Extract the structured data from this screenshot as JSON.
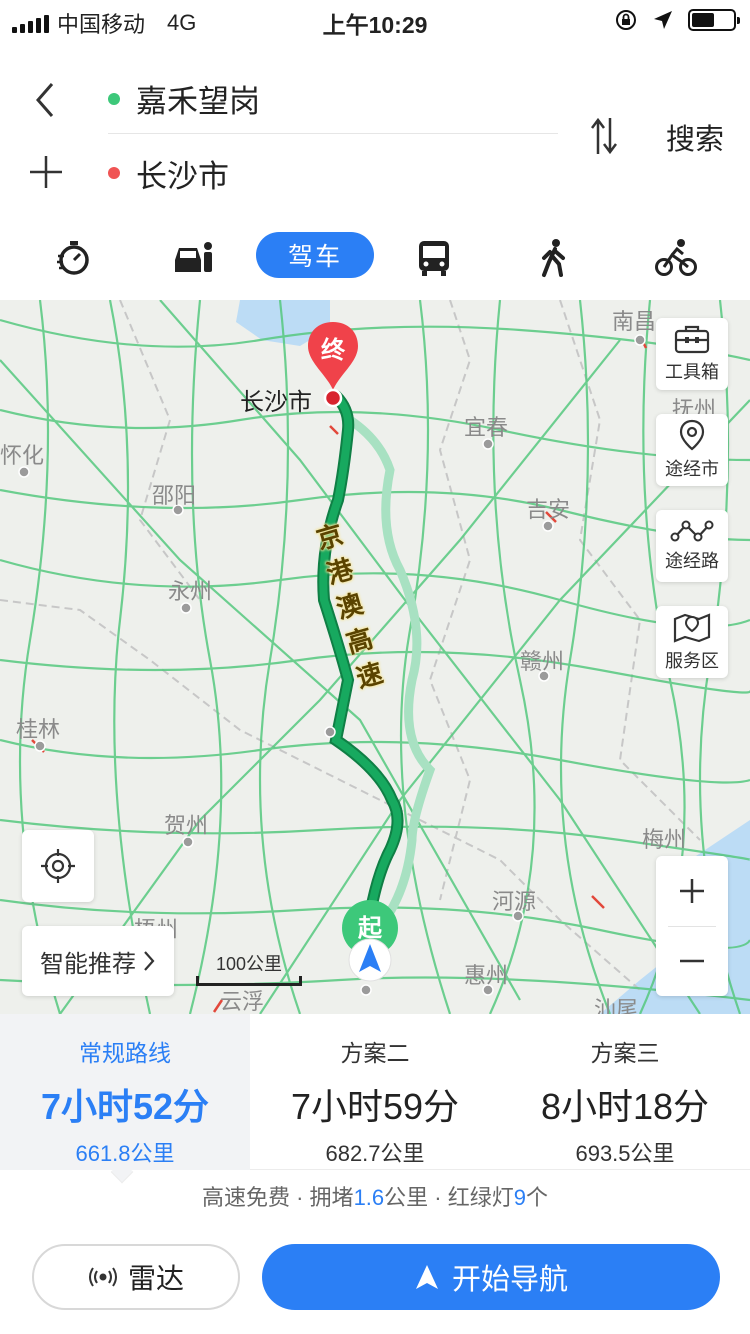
{
  "status_bar": {
    "carrier": "中国移动",
    "network": "4G",
    "time": "上午10:29",
    "battery_level": 0.55
  },
  "route_input": {
    "origin": "嘉禾望岗",
    "destination": "长沙市",
    "search_label": "搜索",
    "origin_dot_color": "#3dc87a",
    "destination_dot_color": "#f05454"
  },
  "modes": {
    "active_label": "驾车",
    "items": [
      "timer-icon",
      "taxi-icon",
      "drive",
      "bus-icon",
      "walk-icon",
      "bike-icon"
    ]
  },
  "map": {
    "labels": {
      "nanchang": "南昌",
      "fuzhou": "抚州",
      "yichun": "宜春",
      "jian": "吉安",
      "huaihua": "怀化",
      "shaoyang": "邵阳",
      "yongzhou": "永州",
      "ganzhou": "赣州",
      "guilin": "桂林",
      "hezhou": "贺州",
      "meizhou": "梅州",
      "heyuan": "河源",
      "huizhou": "惠州",
      "wuzhou": "梧州",
      "yunfu": "云浮",
      "shanwei": "汕尾",
      "changsha": "长沙市"
    },
    "end_marker": "终",
    "start_marker": "起",
    "highway_label": "京港澳高速",
    "tools": {
      "toolbox": "工具箱",
      "via_city": "途经市",
      "via_road": "途经路",
      "service_area": "服务区"
    },
    "recommend_label": "智能推荐",
    "scale_label": "100公里",
    "route_color": "#17a95f",
    "alt_route_color": "#a8e1c2"
  },
  "routes": [
    {
      "name": "常规路线",
      "time": "7小时52分",
      "distance": "661.8公里"
    },
    {
      "name": "方案二",
      "time": "7小时59分",
      "distance": "682.7公里"
    },
    {
      "name": "方案三",
      "time": "8小时18分",
      "distance": "693.5公里"
    }
  ],
  "summary": {
    "part1": "高速免费 · 拥堵",
    "congestion": "1.6",
    "part2": "公里 · 红绿灯",
    "lights": "9",
    "part3": "个"
  },
  "actions": {
    "radar": "雷达",
    "navigate": "开始导航"
  },
  "colors": {
    "accent": "#2b7ff5"
  }
}
